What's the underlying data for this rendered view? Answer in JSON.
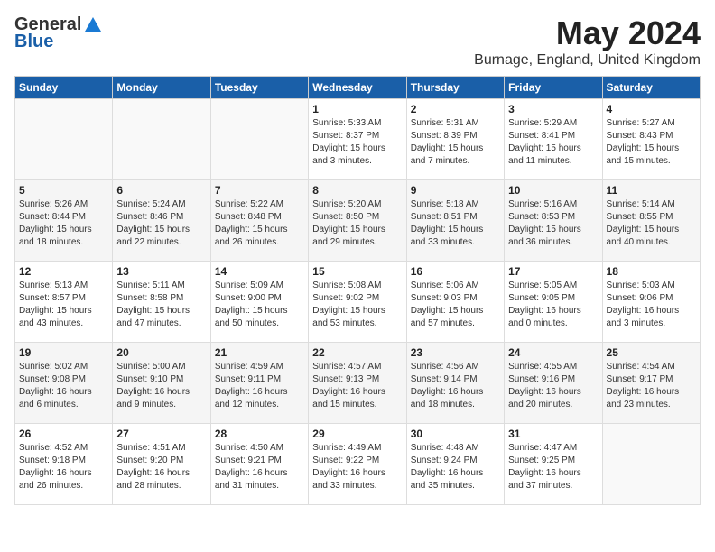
{
  "header": {
    "logo_general": "General",
    "logo_blue": "Blue",
    "month": "May 2024",
    "location": "Burnage, England, United Kingdom"
  },
  "days_of_week": [
    "Sunday",
    "Monday",
    "Tuesday",
    "Wednesday",
    "Thursday",
    "Friday",
    "Saturday"
  ],
  "weeks": [
    [
      {
        "day": "",
        "content": ""
      },
      {
        "day": "",
        "content": ""
      },
      {
        "day": "",
        "content": ""
      },
      {
        "day": "1",
        "content": "Sunrise: 5:33 AM\nSunset: 8:37 PM\nDaylight: 15 hours\nand 3 minutes."
      },
      {
        "day": "2",
        "content": "Sunrise: 5:31 AM\nSunset: 8:39 PM\nDaylight: 15 hours\nand 7 minutes."
      },
      {
        "day": "3",
        "content": "Sunrise: 5:29 AM\nSunset: 8:41 PM\nDaylight: 15 hours\nand 11 minutes."
      },
      {
        "day": "4",
        "content": "Sunrise: 5:27 AM\nSunset: 8:43 PM\nDaylight: 15 hours\nand 15 minutes."
      }
    ],
    [
      {
        "day": "5",
        "content": "Sunrise: 5:26 AM\nSunset: 8:44 PM\nDaylight: 15 hours\nand 18 minutes."
      },
      {
        "day": "6",
        "content": "Sunrise: 5:24 AM\nSunset: 8:46 PM\nDaylight: 15 hours\nand 22 minutes."
      },
      {
        "day": "7",
        "content": "Sunrise: 5:22 AM\nSunset: 8:48 PM\nDaylight: 15 hours\nand 26 minutes."
      },
      {
        "day": "8",
        "content": "Sunrise: 5:20 AM\nSunset: 8:50 PM\nDaylight: 15 hours\nand 29 minutes."
      },
      {
        "day": "9",
        "content": "Sunrise: 5:18 AM\nSunset: 8:51 PM\nDaylight: 15 hours\nand 33 minutes."
      },
      {
        "day": "10",
        "content": "Sunrise: 5:16 AM\nSunset: 8:53 PM\nDaylight: 15 hours\nand 36 minutes."
      },
      {
        "day": "11",
        "content": "Sunrise: 5:14 AM\nSunset: 8:55 PM\nDaylight: 15 hours\nand 40 minutes."
      }
    ],
    [
      {
        "day": "12",
        "content": "Sunrise: 5:13 AM\nSunset: 8:57 PM\nDaylight: 15 hours\nand 43 minutes."
      },
      {
        "day": "13",
        "content": "Sunrise: 5:11 AM\nSunset: 8:58 PM\nDaylight: 15 hours\nand 47 minutes."
      },
      {
        "day": "14",
        "content": "Sunrise: 5:09 AM\nSunset: 9:00 PM\nDaylight: 15 hours\nand 50 minutes."
      },
      {
        "day": "15",
        "content": "Sunrise: 5:08 AM\nSunset: 9:02 PM\nDaylight: 15 hours\nand 53 minutes."
      },
      {
        "day": "16",
        "content": "Sunrise: 5:06 AM\nSunset: 9:03 PM\nDaylight: 15 hours\nand 57 minutes."
      },
      {
        "day": "17",
        "content": "Sunrise: 5:05 AM\nSunset: 9:05 PM\nDaylight: 16 hours\nand 0 minutes."
      },
      {
        "day": "18",
        "content": "Sunrise: 5:03 AM\nSunset: 9:06 PM\nDaylight: 16 hours\nand 3 minutes."
      }
    ],
    [
      {
        "day": "19",
        "content": "Sunrise: 5:02 AM\nSunset: 9:08 PM\nDaylight: 16 hours\nand 6 minutes."
      },
      {
        "day": "20",
        "content": "Sunrise: 5:00 AM\nSunset: 9:10 PM\nDaylight: 16 hours\nand 9 minutes."
      },
      {
        "day": "21",
        "content": "Sunrise: 4:59 AM\nSunset: 9:11 PM\nDaylight: 16 hours\nand 12 minutes."
      },
      {
        "day": "22",
        "content": "Sunrise: 4:57 AM\nSunset: 9:13 PM\nDaylight: 16 hours\nand 15 minutes."
      },
      {
        "day": "23",
        "content": "Sunrise: 4:56 AM\nSunset: 9:14 PM\nDaylight: 16 hours\nand 18 minutes."
      },
      {
        "day": "24",
        "content": "Sunrise: 4:55 AM\nSunset: 9:16 PM\nDaylight: 16 hours\nand 20 minutes."
      },
      {
        "day": "25",
        "content": "Sunrise: 4:54 AM\nSunset: 9:17 PM\nDaylight: 16 hours\nand 23 minutes."
      }
    ],
    [
      {
        "day": "26",
        "content": "Sunrise: 4:52 AM\nSunset: 9:18 PM\nDaylight: 16 hours\nand 26 minutes."
      },
      {
        "day": "27",
        "content": "Sunrise: 4:51 AM\nSunset: 9:20 PM\nDaylight: 16 hours\nand 28 minutes."
      },
      {
        "day": "28",
        "content": "Sunrise: 4:50 AM\nSunset: 9:21 PM\nDaylight: 16 hours\nand 31 minutes."
      },
      {
        "day": "29",
        "content": "Sunrise: 4:49 AM\nSunset: 9:22 PM\nDaylight: 16 hours\nand 33 minutes."
      },
      {
        "day": "30",
        "content": "Sunrise: 4:48 AM\nSunset: 9:24 PM\nDaylight: 16 hours\nand 35 minutes."
      },
      {
        "day": "31",
        "content": "Sunrise: 4:47 AM\nSunset: 9:25 PM\nDaylight: 16 hours\nand 37 minutes."
      },
      {
        "day": "",
        "content": ""
      }
    ]
  ]
}
